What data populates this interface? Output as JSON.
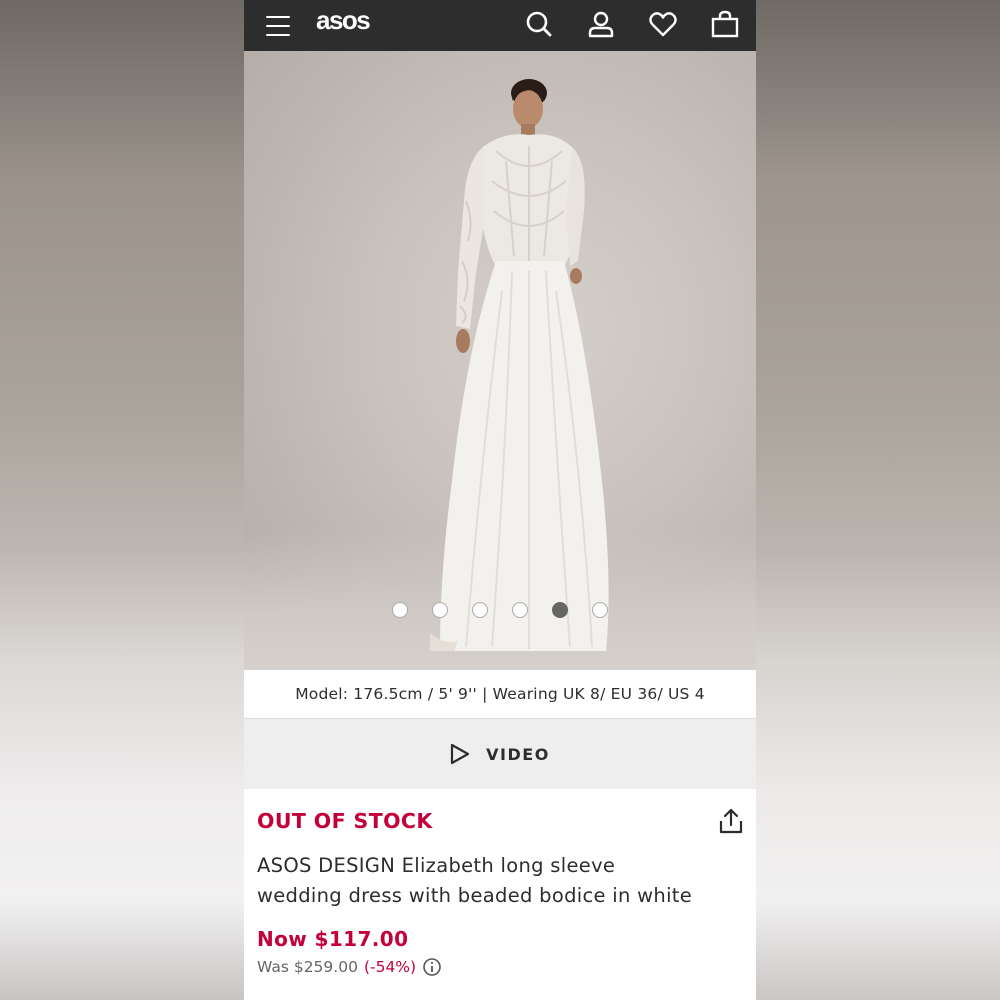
{
  "header": {
    "logo": "asos"
  },
  "gallery": {
    "dots_count": 6,
    "active_index": 4
  },
  "model_info": "Model: 176.5cm / 5' 9'' | Wearing UK 8/ EU 36/ US 4",
  "video": {
    "label": "VIDEO"
  },
  "product": {
    "stock_status": "OUT OF STOCK",
    "title": "ASOS DESIGN Elizabeth long sleeve wedding dress with beaded bodice in white",
    "now_price": "Now $117.00",
    "was_price": "Was $259.00",
    "discount": "(-54%)"
  },
  "colors": {
    "topbar": "#2d2d2d",
    "sale_red": "#c4003a"
  },
  "icons": [
    "menu-icon",
    "search-icon",
    "account-icon",
    "heart-icon",
    "bag-icon",
    "play-icon",
    "share-icon",
    "info-icon"
  ]
}
